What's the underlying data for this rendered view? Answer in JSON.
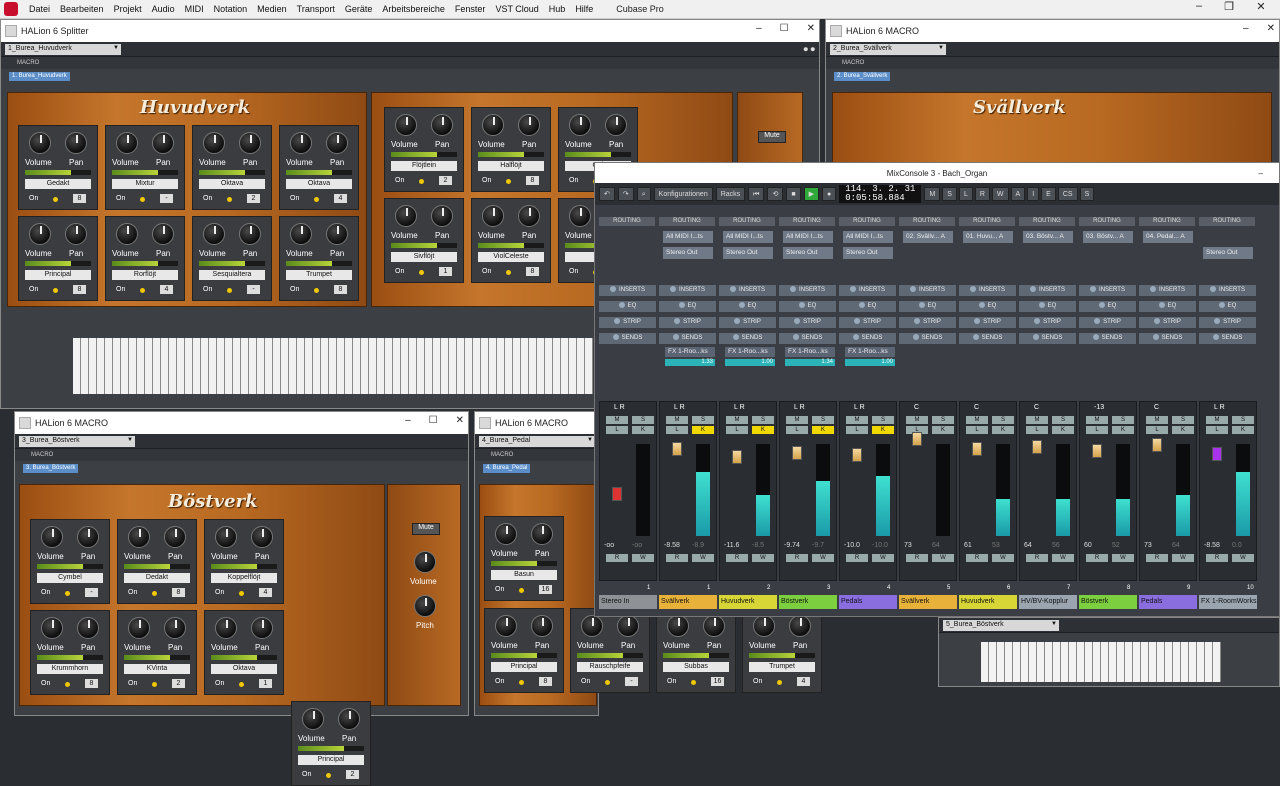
{
  "app": {
    "title": "Cubase Pro",
    "menu": [
      "Datei",
      "Bearbeiten",
      "Projekt",
      "Audio",
      "MIDI",
      "Notation",
      "Medien",
      "Transport",
      "Geräte",
      "Arbeitsbereiche",
      "Fenster",
      "VST Cloud",
      "Hub",
      "Hilfe"
    ]
  },
  "windows": {
    "splitter": {
      "title": "HALion 6 Splitter",
      "preset": "1_Burea_Huvudverk",
      "chip": "1. Burea_Huvudverk",
      "panel": "Huvudverk"
    },
    "macro_sv": {
      "title": "HALion 6 MACRO",
      "preset": "2_Burea_Svällverk",
      "chip": "2. Burea_Svällverk",
      "panel": "Svällverk"
    },
    "macro_bo": {
      "title": "HALion 6 MACRO",
      "preset": "3_Burea_Böstverk",
      "chip": "3. Burea_Böstverk",
      "panel": "Böstverk"
    },
    "macro_pe": {
      "title": "HALion 6 MACRO",
      "preset": "4_Burea_Pedal",
      "chip": "4. Burea_Pedal"
    },
    "macro_5": {
      "preset": "5_Burea_Böstverk"
    }
  },
  "labels": {
    "macro": "MACRO",
    "volume": "Volume",
    "pan": "Pan",
    "on": "On",
    "mute": "Mute",
    "pitch": "Pitch"
  },
  "stops": {
    "huv": [
      {
        "n": "Gedakt",
        "v": "8"
      },
      {
        "n": "Mixtur",
        "v": "-"
      },
      {
        "n": "Oktava",
        "v": "2"
      },
      {
        "n": "Oktava",
        "v": "4"
      },
      {
        "n": "Principal",
        "v": "8"
      },
      {
        "n": "Rorflöjt",
        "v": "4"
      },
      {
        "n": "Sesquialtera",
        "v": "-"
      },
      {
        "n": "Trumpet",
        "v": "8"
      }
    ],
    "huv2": [
      {
        "n": "Flöjtlein",
        "v": "2"
      },
      {
        "n": "Halflöjt",
        "v": "8"
      },
      {
        "n": "Gei",
        "v": ""
      },
      {
        "n": "Sivflöjt",
        "v": "1"
      },
      {
        "n": "ViolCeleste",
        "v": "8"
      },
      {
        "n": "V",
        "v": ""
      }
    ],
    "bo": [
      {
        "n": "Cymbel",
        "v": "-"
      },
      {
        "n": "Dedakt",
        "v": "8"
      },
      {
        "n": "Koppelflöjt",
        "v": "4"
      },
      {
        "n": "Krummhorn",
        "v": "8"
      },
      {
        "n": "KVinta",
        "v": "2"
      },
      {
        "n": "Oktava",
        "v": "1"
      },
      {
        "n": "Principal",
        "v": "2"
      }
    ],
    "pe": [
      {
        "n": "Basun",
        "v": "16"
      },
      {
        "n": "Principal",
        "v": "8"
      },
      {
        "n": "Rauschpfeife",
        "v": "-"
      },
      {
        "n": "Subbas",
        "v": "16"
      },
      {
        "n": "Trumpet",
        "v": "4"
      }
    ]
  },
  "mix": {
    "title": "MixConsole 3 - Bach_Organ",
    "toolbar": {
      "config": "Konfigurationen",
      "racks": "Racks",
      "time": "114. 3. 2. 31",
      "time2": "0:05:58.884",
      "modes": [
        "M",
        "S",
        "L",
        "R",
        "W",
        "A"
      ],
      "modes2": [
        "I",
        "E",
        "CS",
        "S"
      ]
    },
    "sections": {
      "routing": "ROUTING",
      "inserts": "INSERTS",
      "eq": "EQ",
      "strip": "STRIP",
      "sends": "SENDS"
    },
    "routing_in": [
      "All MIDI I...ts",
      "All MIDI I...ts",
      "All MIDI I...ts",
      "All MIDI I...ts",
      "02. Svällv... A",
      "01. Huvu... A",
      "03. Böstv... A",
      "03. Böstv... A",
      "04. Pedal... A"
    ],
    "routing_out": [
      "Stereo Out",
      "Stereo Out",
      "Stereo Out",
      "Stereo Out",
      "",
      "",
      "",
      "",
      "",
      "Stereo Out"
    ],
    "sends": [
      {
        "n": "FX 1-Roo...ks",
        "v": "1.33"
      },
      {
        "n": "FX 1-Roo...ks",
        "v": "1.00"
      },
      {
        "n": "FX 1-Roo...ks",
        "v": "1.34"
      },
      {
        "n": "FX 1-Roo...ks",
        "v": "1.00"
      }
    ],
    "pans": [
      "L R",
      "L R",
      "L R",
      "L R",
      "L R",
      "C",
      "C",
      "C",
      "-13",
      "C",
      "L R"
    ],
    "values": [
      [
        "-oo",
        "-oo"
      ],
      [
        "-8.58",
        "-8.9"
      ],
      [
        "-11.6",
        "-8.5"
      ],
      [
        "-9.74",
        "-9.7"
      ],
      [
        "-10.0",
        "-10.0"
      ],
      [
        "73",
        "64"
      ],
      [
        "61",
        "53"
      ],
      [
        "64",
        "56"
      ],
      [
        "60",
        "52"
      ],
      [
        "73",
        "64"
      ],
      [
        "-8.58",
        "0.0"
      ]
    ],
    "channels": [
      {
        "n": "Stereo In",
        "c": "#8e9296",
        "num": "1"
      },
      {
        "n": "Svällverk",
        "c": "#e8b23a",
        "num": "1"
      },
      {
        "n": "Huvudverk",
        "c": "#d7d636",
        "num": "2"
      },
      {
        "n": "Böstverk",
        "c": "#7ccf3e",
        "num": "3"
      },
      {
        "n": "Pedals",
        "c": "#8a6ee0",
        "num": "4"
      },
      {
        "n": "Svällverk",
        "c": "#e8b23a",
        "num": "5"
      },
      {
        "n": "Huvudverk",
        "c": "#d7d636",
        "num": "6"
      },
      {
        "n": "HV/BV-Kopplur",
        "c": "#9aa5b0",
        "num": "7"
      },
      {
        "n": "Böstverk",
        "c": "#7ccf3e",
        "num": "8"
      },
      {
        "n": "Pedals",
        "c": "#8a6ee0",
        "num": "9"
      },
      {
        "n": "FX 1-RoomWorks",
        "c": "#9aa5b0",
        "num": "10"
      }
    ]
  }
}
